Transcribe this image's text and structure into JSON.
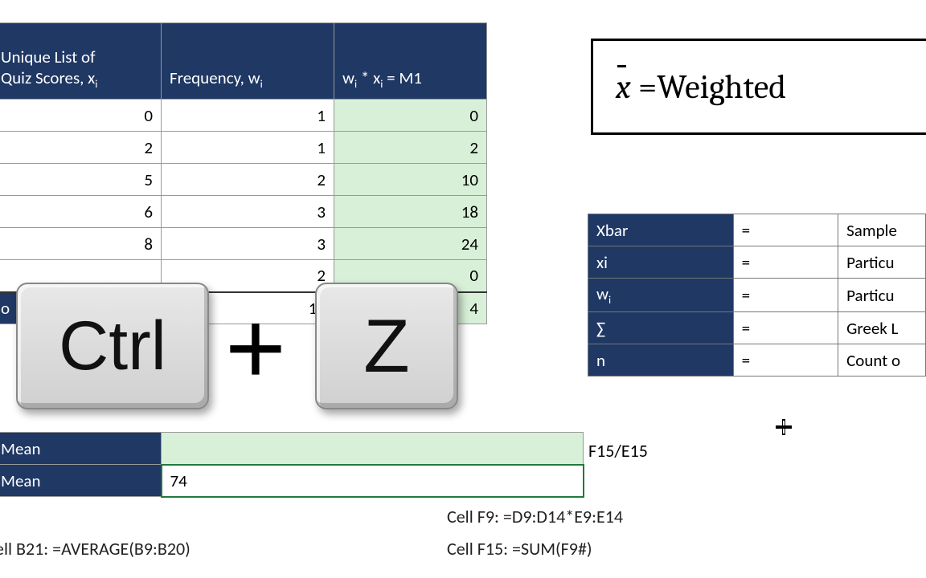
{
  "headers": {
    "col_a_line1": "Unique List of",
    "col_a_line2": "Quiz Scores, x",
    "col_a_sub": "i",
    "col_b": "Frequency, w",
    "col_b_sub": "i",
    "col_c_pre": "w",
    "col_c_mid": " * x",
    "col_c_post": " = M1"
  },
  "rows": [
    {
      "x": "0",
      "w": "1",
      "m": "0"
    },
    {
      "x": "2",
      "w": "1",
      "m": "2"
    },
    {
      "x": "5",
      "w": "2",
      "m": "10"
    },
    {
      "x": "6",
      "w": "3",
      "m": "18"
    },
    {
      "x": "8",
      "w": "3",
      "m": "24"
    },
    {
      "x": "",
      "w": "2",
      "m": "0"
    }
  ],
  "totals": {
    "label_partial": "o",
    "w": "12",
    "m_partial": "4"
  },
  "mean": {
    "label": "Mean",
    "val1": "",
    "val2": "74"
  },
  "bottom": {
    "b21": "ell B21: =AVERAGE(B9:B20)",
    "f9": "Cell F9: =D9:D14*E9:E14",
    "f15": "Cell F15: =SUM(F9#)"
  },
  "formula_box": {
    "rhs": " Weighted "
  },
  "legend": [
    {
      "sym": "Xbar",
      "eq": "=",
      "desc": "Sample"
    },
    {
      "sym": "xi",
      "eq": "=",
      "desc": "Particu"
    },
    {
      "sym_html": "w<sub>i</sub>",
      "eq": "=",
      "desc": "Particu"
    },
    {
      "sym": "∑",
      "eq": "=",
      "desc": "Greek L"
    },
    {
      "sym": "n",
      "eq": "=",
      "desc": "Count o"
    }
  ],
  "f15e15": "F15/E15",
  "keys": {
    "ctrl": "Ctrl",
    "plus": "+",
    "z": "Z"
  }
}
